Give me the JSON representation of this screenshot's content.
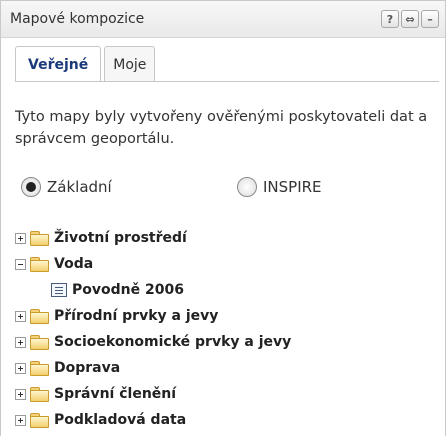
{
  "panel": {
    "title": "Mapové kompozice",
    "tools": [
      "?",
      "⇔",
      "–"
    ]
  },
  "tabs": [
    {
      "label": "Veřejné",
      "active": true
    },
    {
      "label": "Moje",
      "active": false
    }
  ],
  "intro_text": "Tyto mapy byly vytvořeny ověřenými poskytovateli dat a správcem geoportálu.",
  "radios": [
    {
      "label": "Základní",
      "checked": true
    },
    {
      "label": "INSPIRE",
      "checked": false
    }
  ],
  "tree": [
    {
      "label": "Životní prostředí",
      "expanded": false,
      "type": "folder"
    },
    {
      "label": "Voda",
      "expanded": true,
      "type": "folder"
    },
    {
      "label": "Povodně 2006",
      "type": "document"
    },
    {
      "label": "Přírodní prvky a jevy",
      "expanded": false,
      "type": "folder"
    },
    {
      "label": "Socioekonomické prvky a jevy",
      "expanded": false,
      "type": "folder"
    },
    {
      "label": "Doprava",
      "expanded": false,
      "type": "folder"
    },
    {
      "label": "Správní členění",
      "expanded": false,
      "type": "folder"
    },
    {
      "label": "Podkladová data",
      "expanded": false,
      "type": "folder"
    }
  ]
}
